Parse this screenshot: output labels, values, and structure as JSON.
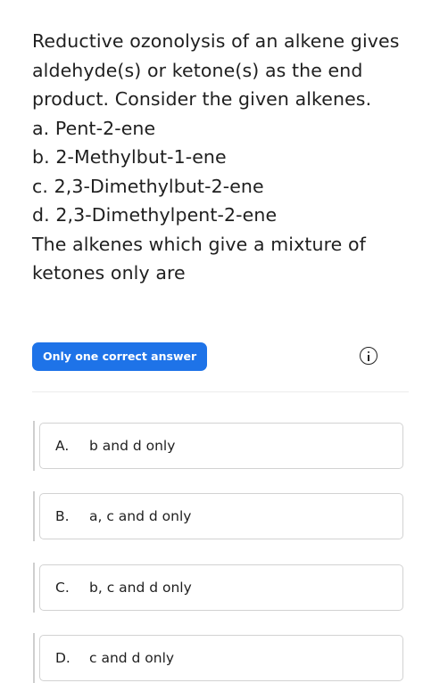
{
  "question": {
    "lines": [
      "Reductive ozonolysis of an alkene gives",
      "aldehyde(s) or ketone(s) as the end",
      "product. Consider the given alkenes.",
      "a. Pent-2-ene",
      "b. 2-Methylbut-1-ene",
      "c. 2,3-Dimethylbut-2-ene",
      "d. 2,3-Dimethylpent-2-ene",
      "The alkenes which give a mixture of",
      "ketones only are"
    ]
  },
  "answer_type_badge": "Only one correct answer",
  "info_icon": "info-icon",
  "colors": {
    "badge": "#1e73e8",
    "border": "#d2d2d2"
  },
  "options": [
    {
      "letter": "A.",
      "text": "b and d only"
    },
    {
      "letter": "B.",
      "text": "a, c and d only"
    },
    {
      "letter": "C.",
      "text": "b, c and d only"
    },
    {
      "letter": "D.",
      "text": "c and d only"
    }
  ]
}
